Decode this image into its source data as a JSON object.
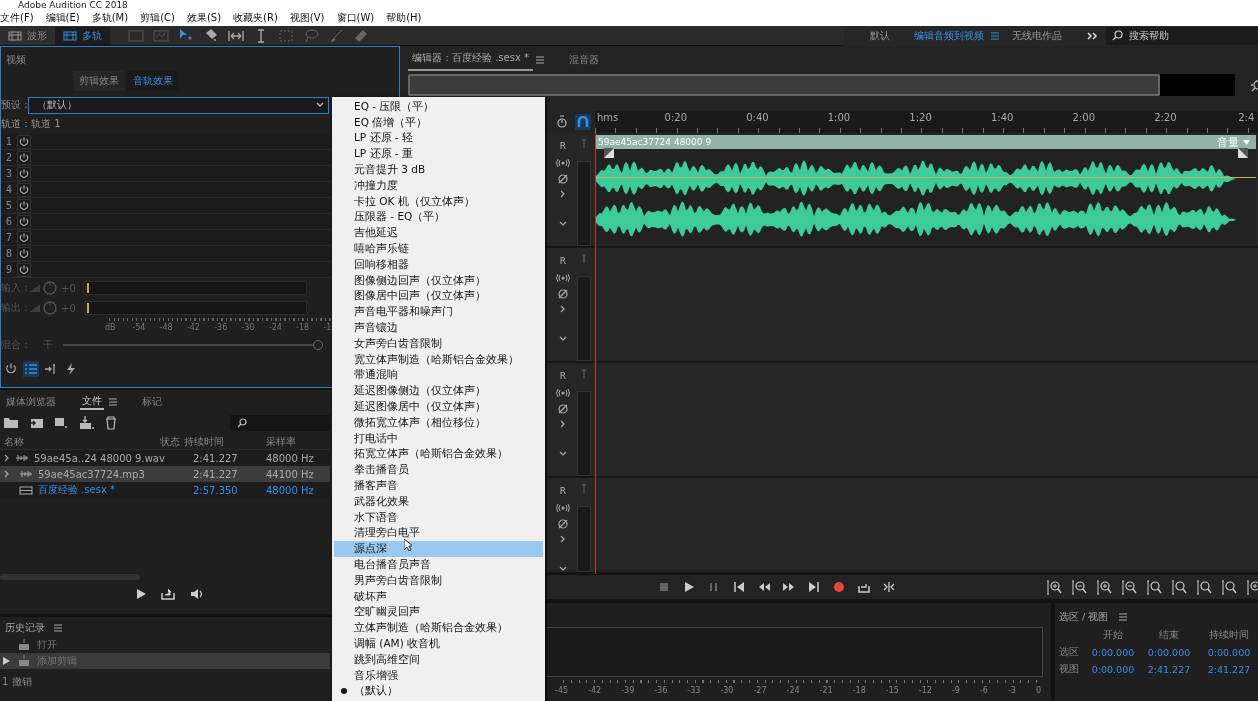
{
  "window": {
    "title": "Adobe Audition CC 2018"
  },
  "menu_bar": [
    "文件(F)",
    "编辑(E)",
    "多轨(M)",
    "剪辑(C)",
    "效果(S)",
    "收藏夹(R)",
    "视图(V)",
    "窗口(W)",
    "帮助(H)"
  ],
  "toolbar": {
    "modes": [
      {
        "label": "波形",
        "selected": false
      },
      {
        "label": "多轨",
        "selected": true
      }
    ],
    "workspaces": [
      {
        "label": "默认",
        "selected": false
      },
      {
        "label": "编辑音频到视频",
        "selected": true
      },
      {
        "label": "无线电作品",
        "selected": false
      }
    ],
    "search": {
      "placeholder": "搜索帮助"
    }
  },
  "effects_panel": {
    "title": "视频",
    "subtabs": [
      {
        "label": "剪辑效果",
        "selected": false
      },
      {
        "label": "音轨效果",
        "selected": true
      }
    ],
    "preset_label": "预设：",
    "preset_value": "（默认）",
    "track_label": "轨道：轨道 1",
    "slots": [
      "1",
      "2",
      "3",
      "4",
      "5",
      "6",
      "7",
      "8",
      "9"
    ],
    "io": [
      {
        "label": "输入：",
        "gain": "+0"
      },
      {
        "label": "输出：",
        "gain": "+0"
      }
    ],
    "scale": [
      "dB",
      "-54",
      "-48",
      "-42",
      "-36",
      "-30",
      "-24",
      "-18",
      "-1"
    ],
    "mix": {
      "label": "混合：",
      "dry": "干",
      "level": 1
    }
  },
  "files_panel": {
    "tabs": [
      {
        "label": "媒体浏览器",
        "selected": false
      },
      {
        "label": "文件",
        "selected": true
      },
      {
        "label": "标记",
        "selected": false
      }
    ],
    "columns": [
      "名称",
      "状态",
      "持续时间",
      "采样率"
    ],
    "rows": [
      {
        "kind": "audio",
        "name": "59ae45a..24 48000 9.wav",
        "duration": "2:41.227",
        "rate": "48000 Hz",
        "selected": false
      },
      {
        "kind": "audio",
        "name": "59ae45ac37724.mp3",
        "duration": "2:41.227",
        "rate": "44100 Hz",
        "selected": true
      },
      {
        "kind": "session",
        "name": "百度经验 .sesx *",
        "duration": "2:57.350",
        "rate": "48000 Hz",
        "selected": false
      }
    ]
  },
  "history_panel": {
    "title": "历史记录",
    "items": [
      {
        "label": "打开",
        "selected": false
      },
      {
        "label": "添加剪辑",
        "selected": true
      }
    ],
    "undo": "1 撤销"
  },
  "effects_menu": {
    "items": [
      {
        "label": "EQ - 压限（平）",
        "selected": false,
        "checked": false
      },
      {
        "label": "EQ 倍增（平）",
        "selected": false,
        "checked": false
      },
      {
        "label": "LP 还原 - 轻",
        "selected": false,
        "checked": false
      },
      {
        "label": "LP 还原 - 重",
        "selected": false,
        "checked": false
      },
      {
        "label": "元音提升 3 dB",
        "selected": false,
        "checked": false
      },
      {
        "label": "冲撞力度",
        "selected": false,
        "checked": false
      },
      {
        "label": "卡拉 OK 机（仅立体声）",
        "selected": false,
        "checked": false
      },
      {
        "label": "压限器 - EQ（平）",
        "selected": false,
        "checked": false
      },
      {
        "label": "吉他延迟",
        "selected": false,
        "checked": false
      },
      {
        "label": "嘻哈声乐链",
        "selected": false,
        "checked": false
      },
      {
        "label": "回响移相器",
        "selected": false,
        "checked": false
      },
      {
        "label": "图像侧边回声（仅立体声）",
        "selected": false,
        "checked": false
      },
      {
        "label": "图像居中回声（仅立体声）",
        "selected": false,
        "checked": false
      },
      {
        "label": "声音电平器和噪声门",
        "selected": false,
        "checked": false
      },
      {
        "label": "声音镶边",
        "selected": false,
        "checked": false
      },
      {
        "label": "女声旁白齿音限制",
        "selected": false,
        "checked": false
      },
      {
        "label": "宽立体声制造（哈斯铝合金效果）",
        "selected": false,
        "checked": false
      },
      {
        "label": "带通混响",
        "selected": false,
        "checked": false
      },
      {
        "label": "延迟图像侧边（仅立体声）",
        "selected": false,
        "checked": false
      },
      {
        "label": "延迟图像居中（仅立体声）",
        "selected": false,
        "checked": false
      },
      {
        "label": "微拓宽立体声（相位移位）",
        "selected": false,
        "checked": false
      },
      {
        "label": "打电话中",
        "selected": false,
        "checked": false
      },
      {
        "label": "拓宽立体声（哈斯铝合金效果）",
        "selected": false,
        "checked": false
      },
      {
        "label": "拳击播音员",
        "selected": false,
        "checked": false
      },
      {
        "label": "播客声音",
        "selected": false,
        "checked": false
      },
      {
        "label": "武器化效果",
        "selected": false,
        "checked": false
      },
      {
        "label": "水下语音",
        "selected": false,
        "checked": false
      },
      {
        "label": "清理旁白电平",
        "selected": false,
        "checked": false
      },
      {
        "label": "源点深",
        "selected": true,
        "checked": false
      },
      {
        "label": "电台播音员声音",
        "selected": false,
        "checked": false
      },
      {
        "label": "男声旁白齿音限制",
        "selected": false,
        "checked": false
      },
      {
        "label": "破坏声",
        "selected": false,
        "checked": false
      },
      {
        "label": "空旷幽灵回声",
        "selected": false,
        "checked": false
      },
      {
        "label": "立体声制造（哈斯铝合金效果）",
        "selected": false,
        "checked": false
      },
      {
        "label": "调幅 (AM) 收音机",
        "selected": false,
        "checked": false
      },
      {
        "label": "跳到高维空间",
        "selected": false,
        "checked": false
      },
      {
        "label": "音乐增强",
        "selected": false,
        "checked": false
      },
      {
        "label": "（默认）",
        "selected": false,
        "checked": true
      }
    ]
  },
  "editor": {
    "tabs": [
      {
        "label": "编辑器：百度经验 .sesx *",
        "selected": true
      },
      {
        "label": "混音器",
        "selected": false
      }
    ],
    "ruler": [
      "hms",
      "0:20",
      "0:40",
      "1:00",
      "1:20",
      "1:40",
      "2:00",
      "2:20",
      "2:4"
    ],
    "clip": {
      "name": "59ae45ac37724 48000 9",
      "volume_label": "音量"
    },
    "tracks": [
      {
        "record": "R",
        "has_clip": true
      },
      {
        "record": "R",
        "has_clip": false
      },
      {
        "record": "R",
        "has_clip": false
      },
      {
        "record": "R",
        "has_clip": false
      }
    ]
  },
  "level_meter": {
    "scale": [
      "-45",
      "-42",
      "-39",
      "-36",
      "-33",
      "-30",
      "-27",
      "-24",
      "-21",
      "-18",
      "-15",
      "-12",
      "-9",
      "-6",
      "-3",
      "0"
    ]
  },
  "selection_view": {
    "title": "选区 / 视图",
    "columns": [
      "开始",
      "结束",
      "持续时间"
    ],
    "rows": [
      {
        "label": "选区",
        "values": [
          "0:00.000",
          "0:00.000",
          "0:00.000"
        ]
      },
      {
        "label": "视图",
        "values": [
          "0:00.000",
          "2:41.227",
          "2:41.227"
        ]
      }
    ]
  }
}
